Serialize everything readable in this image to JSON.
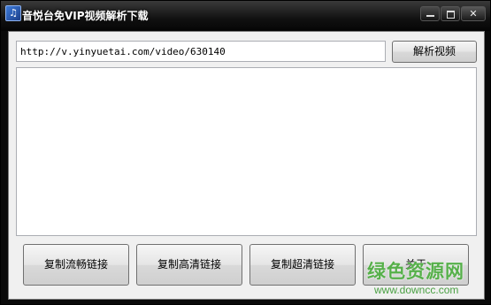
{
  "window": {
    "title": "音悦台免VIP视频解析下载",
    "icon": "music-note-icon",
    "controls": {
      "minimize": "minimize-icon",
      "maximize": "maximize-icon",
      "close": "✕"
    }
  },
  "url_input": {
    "value": "http://v.yinyuetai.com/video/630140"
  },
  "parse_button": {
    "label": "解析视频"
  },
  "output_box": {
    "value": ""
  },
  "bottom_buttons": [
    {
      "label": "复制流畅链接"
    },
    {
      "label": "复制高清链接"
    },
    {
      "label": "复制超清链接"
    },
    {
      "label": "关于"
    }
  ],
  "watermark": {
    "title": "绿色资源网",
    "url": "www.downcc.com"
  },
  "colors": {
    "titlebar": "#111111",
    "client_bg": "#f0f0f0",
    "watermark_green": "#56b04a"
  }
}
